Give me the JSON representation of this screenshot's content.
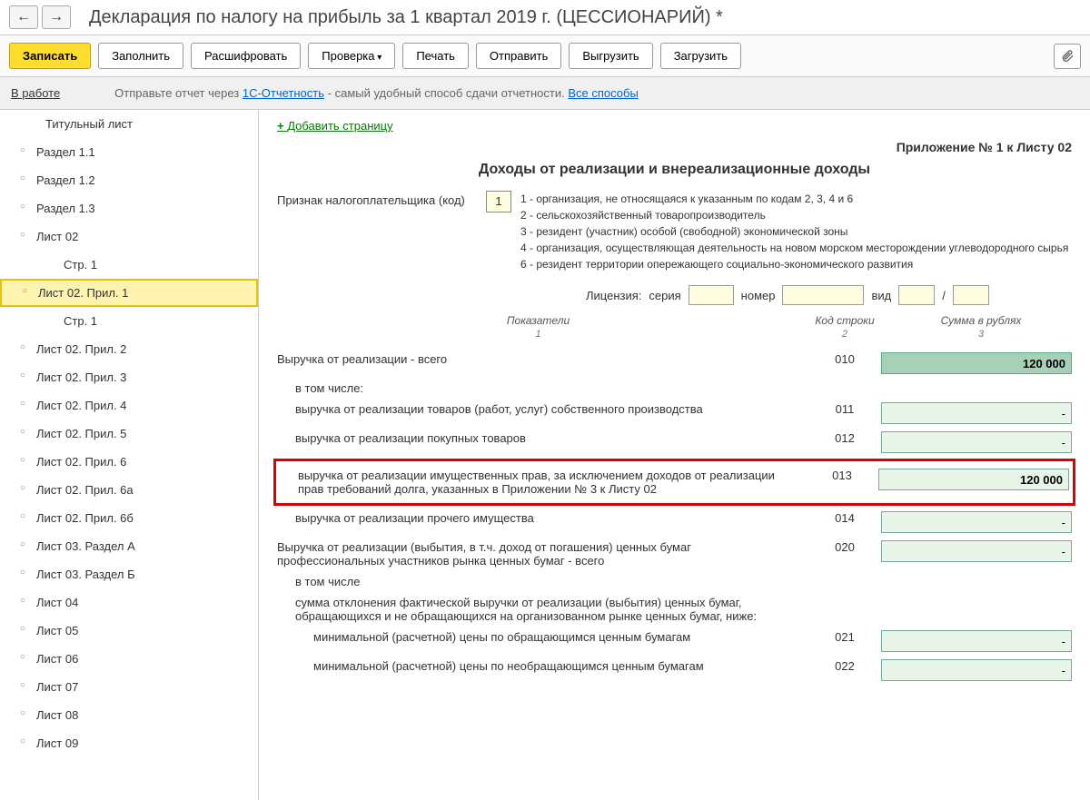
{
  "header": {
    "title": "Декларация по налогу на прибыль за 1 квартал 2019 г. (ЦЕССИОНАРИЙ) *"
  },
  "toolbar": {
    "write": "Записать",
    "fill": "Заполнить",
    "decrypt": "Расшифровать",
    "check": "Проверка",
    "print": "Печать",
    "send": "Отправить",
    "export": "Выгрузить",
    "import": "Загрузить"
  },
  "status": {
    "label": "В работе",
    "text_before": "Отправьте отчет через ",
    "link1": "1С-Отчетность",
    "text_after": " - самый удобный способ сдачи отчетности. ",
    "link2": "Все способы"
  },
  "nav": {
    "items": [
      "Титульный лист",
      "Раздел 1.1",
      "Раздел 1.2",
      "Раздел 1.3",
      "Лист 02",
      "Стр. 1",
      "Лист 02. Прил. 1",
      "Стр. 1",
      "Лист 02. Прил. 2",
      "Лист 02. Прил. 3",
      "Лист 02. Прил. 4",
      "Лист 02. Прил. 5",
      "Лист 02. Прил. 6",
      "Лист 02. Прил. 6а",
      "Лист 02. Прил. 6б",
      "Лист 03. Раздел А",
      "Лист 03. Раздел Б",
      "Лист 04",
      "Лист 05",
      "Лист 06",
      "Лист 07",
      "Лист 08",
      "Лист 09"
    ]
  },
  "content": {
    "add_page": "Добавить страницу",
    "appendix": "Приложение № 1 к Листу 02",
    "section_title": "Доходы от реализации и внереализационные доходы",
    "taxpayer_label": "Признак налогоплательщика (код)",
    "taxpayer_code": "1",
    "code_descriptions": "1 - организация, не относящаяся к указанным по кодам 2, 3, 4 и 6\n2 - сельскохозяйственный товаропроизводитель\n3 - резидент (участник) особой (свободной) экономической зоны\n4 - организация, осуществляющая деятельность на новом морском месторождении углеводородного сырья\n6 - резидент территории опережающего социально-экономического развития",
    "license": {
      "label": "Лицензия:",
      "series": "серия",
      "number": "номер",
      "type": "вид"
    },
    "table_headers": {
      "indicator": "Показатели",
      "code": "Код строки",
      "sum": "Сумма в рублях",
      "n1": "1",
      "n2": "2",
      "n3": "3"
    },
    "rows": [
      {
        "label": "Выручка от реализации - всего",
        "code": "010",
        "value": "120 000",
        "total": true
      },
      {
        "label": "в том числе:",
        "sub": true
      },
      {
        "label": "выручка от реализации товаров (работ, услуг) собственного производства",
        "code": "011",
        "value": "-",
        "indent": 1
      },
      {
        "label": "выручка от реализации покупных товаров",
        "code": "012",
        "value": "-",
        "indent": 1
      },
      {
        "label": "выручка от реализации имущественных прав, за исключением доходов от реализации прав требований долга, указанных в Приложении № 3 к Листу 02",
        "code": "013",
        "value": "120 000",
        "indent": 1,
        "highlight": true,
        "bold": true
      },
      {
        "label": "выручка от реализации прочего имущества",
        "code": "014",
        "value": "-",
        "indent": 1
      },
      {
        "label": "Выручка от реализации (выбытия, в т.ч. доход от погашения) ценных бумаг профессиональных участников рынка ценных бумаг - всего",
        "code": "020",
        "value": "-"
      },
      {
        "label": "в том числе",
        "sub": true
      },
      {
        "label": "сумма отклонения фактической выручки от реализации (выбытия) ценных бумаг, обращающихся и не обращающихся на организованном рынке ценных бумаг, ниже:",
        "indent": 1,
        "textonly": true
      },
      {
        "label": "минимальной (расчетной) цены по обращающимся ценным бумагам",
        "code": "021",
        "value": "-",
        "indent": 2
      },
      {
        "label": "минимальной (расчетной) цены по необращающимся ценным бумагам",
        "code": "022",
        "value": "-",
        "indent": 2
      }
    ]
  }
}
